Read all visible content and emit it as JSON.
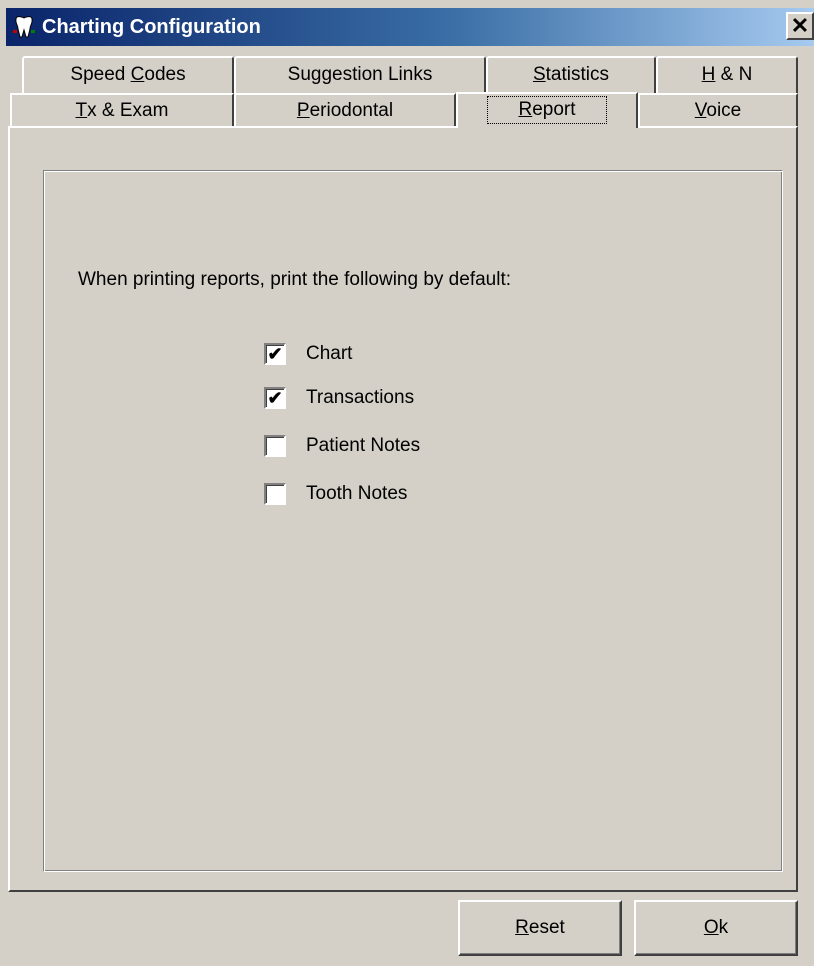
{
  "window": {
    "title": "Charting Configuration"
  },
  "tabs": {
    "row1": [
      {
        "label": "Speed Codes",
        "mnemonic": "C"
      },
      {
        "label": "Suggestion Links",
        "mnemonic": ""
      },
      {
        "label": "Statistics",
        "mnemonic": "S"
      },
      {
        "label": "H & N",
        "mnemonic": "H"
      }
    ],
    "row2": [
      {
        "label": "Tx & Exam",
        "mnemonic": "T"
      },
      {
        "label": "Periodontal",
        "mnemonic": "P"
      },
      {
        "label": "Report",
        "mnemonic": "R",
        "active": true
      },
      {
        "label": "Voice",
        "mnemonic": "V"
      }
    ]
  },
  "report": {
    "prompt": "When printing reports, print the following by default:",
    "options": [
      {
        "label": "Chart",
        "checked": true
      },
      {
        "label": "Transactions",
        "checked": true
      },
      {
        "label": "Patient Notes",
        "checked": false
      },
      {
        "label": "Tooth Notes",
        "checked": false
      }
    ]
  },
  "buttons": {
    "reset": "Reset",
    "ok": "Ok"
  },
  "icons": {
    "app": "tooth-app-icon",
    "close": "close-icon"
  },
  "colors": {
    "face": "#d4d0c8",
    "title_start": "#0a246a",
    "title_end": "#a6caf0"
  }
}
